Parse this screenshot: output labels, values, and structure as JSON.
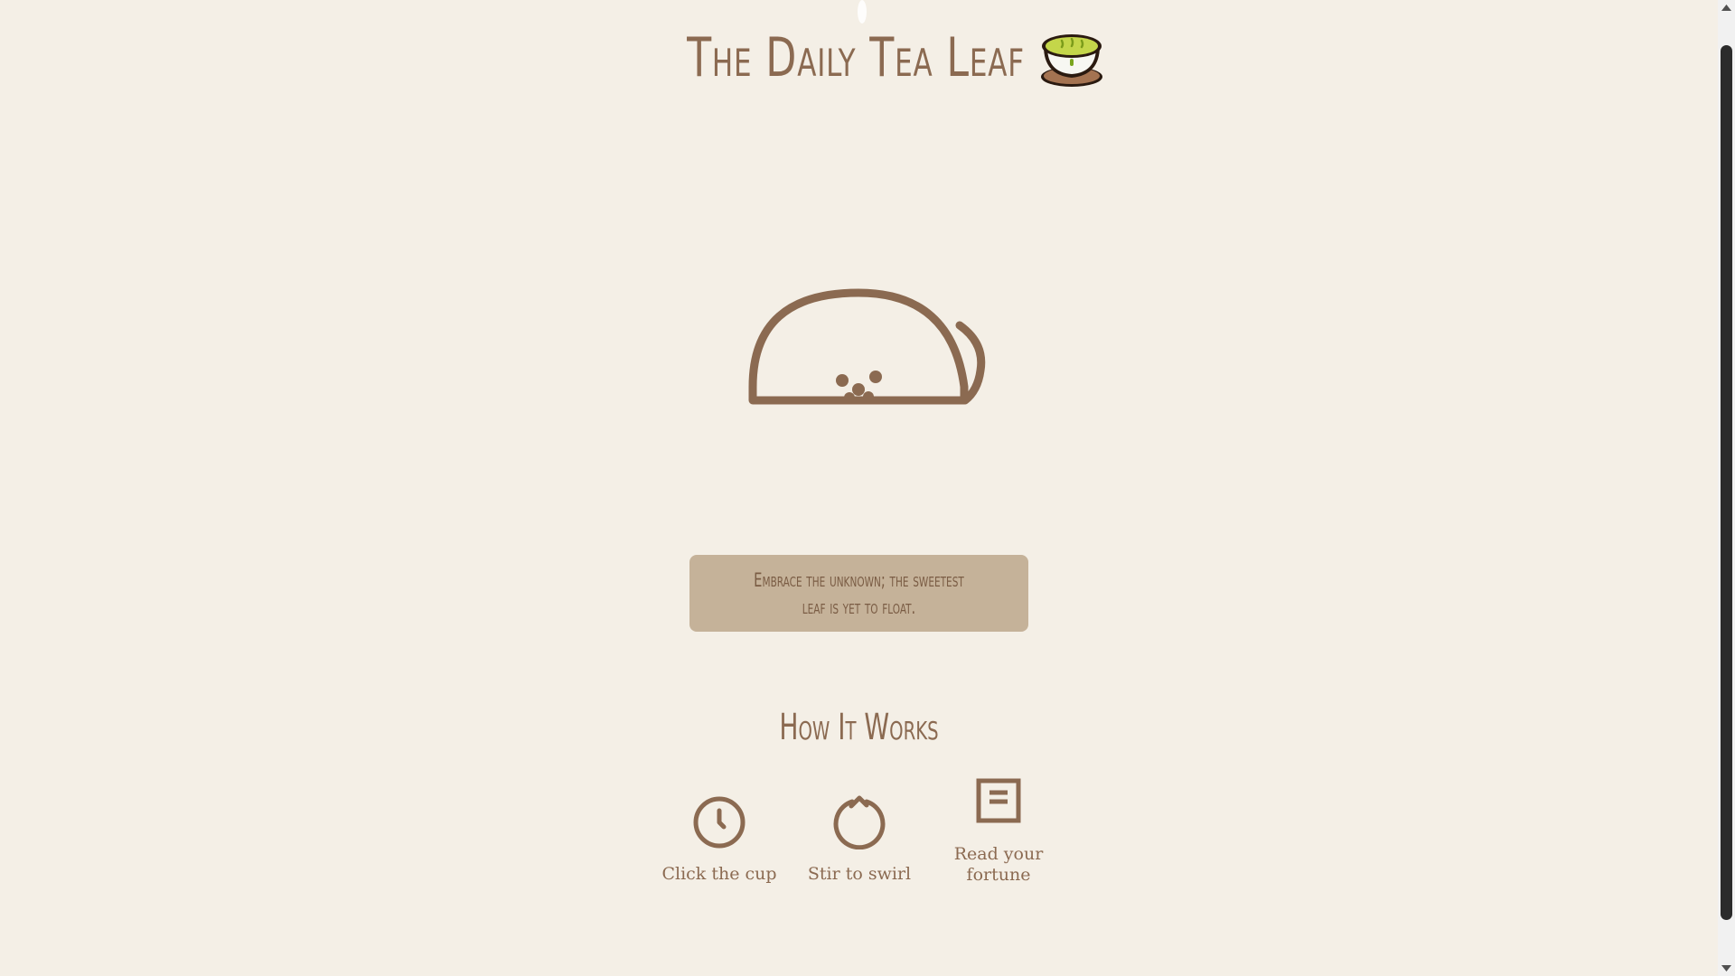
{
  "header": {
    "title": "The Daily Tea Leaf",
    "emoji_icon": "green-tea-cup-icon"
  },
  "cup": {
    "icon": "teacup-icon",
    "color": "#8b6a51"
  },
  "fortune": {
    "text": "Embrace the unknown; the sweetest leaf is yet to float."
  },
  "how_it_works": {
    "title": "How It Works",
    "steps": [
      {
        "icon": "clock-icon",
        "label": "Click the cup"
      },
      {
        "icon": "rotate-icon",
        "label": "Stir to swirl"
      },
      {
        "icon": "document-icon",
        "label": "Read your fortune"
      }
    ]
  },
  "colors": {
    "background": "#f4efe6",
    "accent": "#8b6a51",
    "fortune_box": "#c5b299"
  }
}
